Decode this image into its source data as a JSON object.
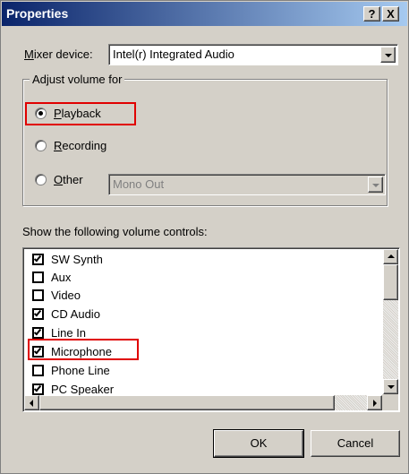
{
  "window": {
    "title": "Properties",
    "help_button": "?",
    "close_button": "X"
  },
  "mixer": {
    "label_prefix": "",
    "label_accel": "M",
    "label_rest": "ixer device:",
    "value": "Intel(r) Integrated Audio"
  },
  "adjust": {
    "group_title": "Adjust volume for",
    "options": [
      {
        "accel": "P",
        "rest": "layback",
        "selected": true
      },
      {
        "accel": "R",
        "rest": "ecording",
        "selected": false
      },
      {
        "accel": "O",
        "rest": "ther",
        "selected": false
      }
    ],
    "other_combo_value": "Mono Out"
  },
  "controls": {
    "heading": "Show the following volume controls:",
    "items": [
      {
        "label": "SW Synth",
        "checked": true
      },
      {
        "label": "Aux",
        "checked": false
      },
      {
        "label": "Video",
        "checked": false
      },
      {
        "label": "CD Audio",
        "checked": true
      },
      {
        "label": "Line In",
        "checked": true
      },
      {
        "label": "Microphone",
        "checked": true
      },
      {
        "label": "Phone Line",
        "checked": false
      },
      {
        "label": "PC Speaker",
        "checked": true
      }
    ]
  },
  "buttons": {
    "ok": "OK",
    "cancel": "Cancel"
  },
  "highlight_color": "#e00000"
}
